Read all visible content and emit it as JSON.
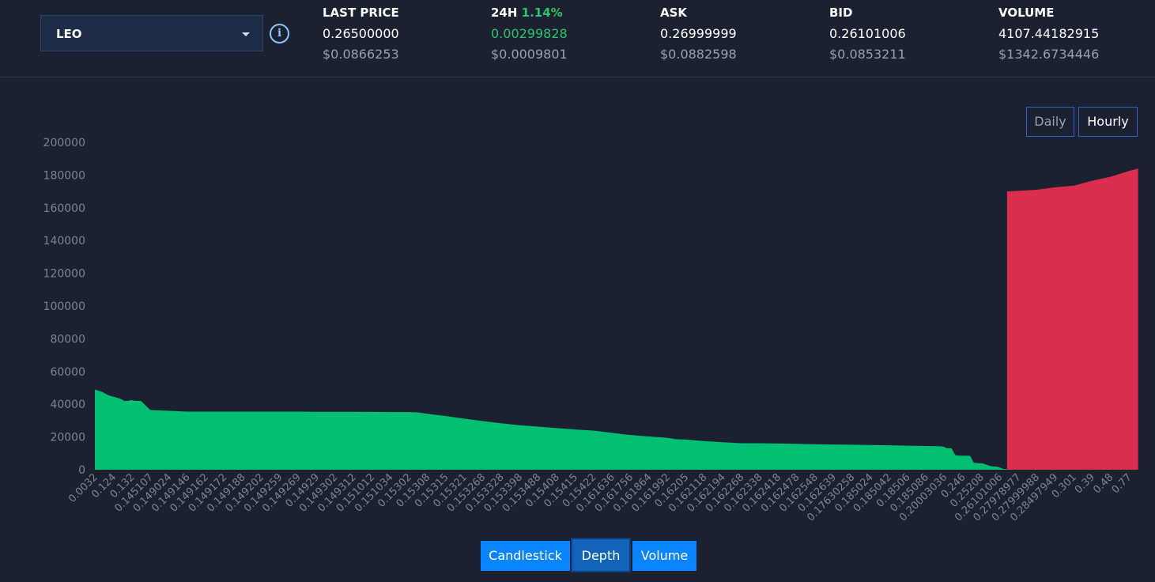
{
  "pair": {
    "label": "LEO"
  },
  "info_icon": "info-circle-icon",
  "stats": [
    {
      "label": "LAST PRICE",
      "pct": "",
      "value": "0.26500000",
      "usd": "$0.0866253",
      "value_color": "white"
    },
    {
      "label": "24H",
      "pct": "1.14%",
      "value": "0.00299828",
      "usd": "$0.0009801",
      "value_color": "green"
    },
    {
      "label": "ASK",
      "pct": "",
      "value": "0.26999999",
      "usd": "$0.0882598",
      "value_color": "white"
    },
    {
      "label": "BID",
      "pct": "",
      "value": "0.26101006",
      "usd": "$0.0853211",
      "value_color": "white"
    },
    {
      "label": "VOLUME",
      "pct": "",
      "value": "4107.44182915",
      "usd": "$1342.6734446",
      "value_color": "white"
    }
  ],
  "range_buttons": {
    "daily": "Daily",
    "hourly": "Hourly",
    "active": "hourly"
  },
  "chart_tabs": {
    "candlestick": "Candlestick",
    "depth": "Depth",
    "volume": "Volume",
    "active": "depth"
  },
  "colors": {
    "bid": "#02bf74",
    "ask": "#da2e4c",
    "background": "#1b2130",
    "accent": "#0a84ff"
  },
  "chart_data": {
    "type": "area",
    "title": "",
    "xlabel": "",
    "ylabel": "",
    "ylim": [
      0,
      200000
    ],
    "yticks": [
      0,
      20000,
      40000,
      60000,
      80000,
      100000,
      120000,
      140000,
      160000,
      180000,
      200000
    ],
    "x_tick_labels": [
      "0.0032",
      "0.124",
      "0.132",
      "0.145107",
      "0.149024",
      "0.149146",
      "0.149162",
      "0.149172",
      "0.149188",
      "0.149202",
      "0.149259",
      "0.149269",
      "0.14929",
      "0.149302",
      "0.149312",
      "0.151012",
      "0.151034",
      "0.15302",
      "0.15308",
      "0.15315",
      "0.15321",
      "0.153268",
      "0.153328",
      "0.153398",
      "0.153488",
      "0.15408",
      "0.15415",
      "0.15422",
      "0.161636",
      "0.161756",
      "0.161864",
      "0.161992",
      "0.16205",
      "0.162118",
      "0.162194",
      "0.162268",
      "0.162338",
      "0.162418",
      "0.162478",
      "0.162548",
      "0.162639",
      "0.17630258",
      "0.185024",
      "0.185042",
      "0.18506",
      "0.185086",
      "0.20003036",
      "0.246",
      "0.25208",
      "0.26101006",
      "0.27978977",
      "0.27999988",
      "0.28497949",
      "0.301",
      "0.39",
      "0.48",
      "0.77"
    ],
    "bids_x_end_index": 49,
    "series": [
      {
        "name": "bids",
        "x_index": [
          0,
          0.15,
          0.4,
          0.65,
          0.85,
          1.05,
          1.35,
          1.6,
          1.8,
          1.95,
          2.2,
          2.5,
          3,
          4,
          5,
          6,
          7,
          8,
          9,
          10,
          11,
          12,
          13,
          14,
          15,
          16,
          17,
          17.5,
          18,
          19,
          20,
          21,
          22,
          23,
          24,
          25,
          26,
          27,
          28,
          29,
          30,
          31,
          31.5,
          32,
          33,
          34,
          35,
          36,
          37,
          38,
          39,
          40,
          41,
          42,
          43,
          44,
          45,
          45.8,
          46,
          46.1,
          46.4,
          46.6,
          46.9,
          47.1,
          47.4,
          47.6,
          48.1,
          48.5,
          48.9,
          49.2,
          49.5,
          49.8
        ],
        "values": [
          49000,
          48500,
          47500,
          46000,
          45000,
          44500,
          43500,
          42000,
          42000,
          42500,
          42000,
          42000,
          36500,
          36000,
          35500,
          35500,
          35500,
          35500,
          35500,
          35500,
          35500,
          35400,
          35400,
          35400,
          35300,
          35200,
          35200,
          35000,
          34200,
          32800,
          31200,
          29700,
          28400,
          27200,
          26300,
          25400,
          24600,
          23900,
          22500,
          21200,
          20300,
          19500,
          18600,
          18400,
          17500,
          16800,
          16200,
          16200,
          16000,
          15800,
          15600,
          15400,
          15300,
          15100,
          14900,
          14700,
          14500,
          14300,
          14000,
          13200,
          13000,
          8800,
          8600,
          8600,
          8500,
          4200,
          3800,
          2200,
          1800,
          500,
          300,
          0
        ]
      },
      {
        "name": "asks",
        "x_index": [
          49.4,
          51,
          52,
          53,
          54,
          55,
          56,
          56.5
        ],
        "values": [
          170000,
          171000,
          172500,
          173500,
          176500,
          179000,
          182500,
          184000
        ]
      }
    ]
  }
}
